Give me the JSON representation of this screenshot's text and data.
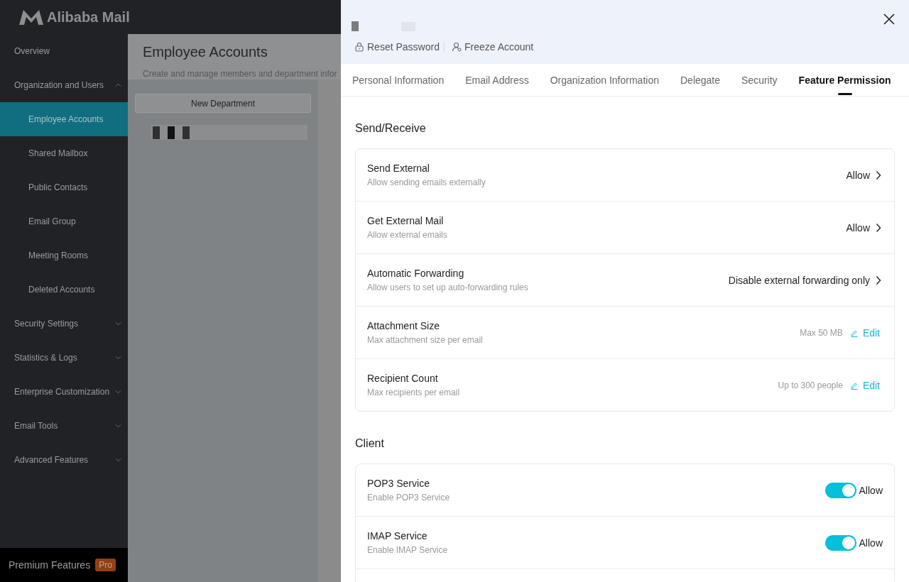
{
  "app": {
    "logo_text": "Alibaba Mail"
  },
  "sidebar": {
    "items": [
      {
        "label": "Overview",
        "kind": "link",
        "selected": false
      },
      {
        "label": "Organization and Users",
        "kind": "group",
        "expanded": true,
        "selected": false,
        "children": [
          {
            "label": "Employee Accounts",
            "selected": true
          },
          {
            "label": "Shared Mailbox",
            "selected": false
          },
          {
            "label": "Public Contacts",
            "selected": false
          },
          {
            "label": "Email Group",
            "selected": false
          },
          {
            "label": "Meeting Rooms",
            "selected": false
          },
          {
            "label": "Deleted Accounts",
            "selected": false
          }
        ]
      },
      {
        "label": "Security Settings",
        "kind": "group",
        "expanded": false,
        "selected": false
      },
      {
        "label": "Statistics & Logs",
        "kind": "group",
        "expanded": false,
        "selected": false
      },
      {
        "label": "Enterprise Customization",
        "kind": "group",
        "expanded": false,
        "selected": false
      },
      {
        "label": "Email Tools",
        "kind": "group",
        "expanded": false,
        "selected": false
      },
      {
        "label": "Advanced Features",
        "kind": "group",
        "expanded": false,
        "selected": false
      }
    ],
    "footer": {
      "label": "Premium Features",
      "badge": "Pro"
    }
  },
  "page": {
    "title": "Employee Accounts",
    "subtitle": "Create and manage members and department infor",
    "new_department_button": "New Department"
  },
  "drawer": {
    "actions": [
      "Reset Password",
      "Freeze Account"
    ],
    "tabs": [
      {
        "label": "Personal Information",
        "selected": false
      },
      {
        "label": "Email Address",
        "selected": false
      },
      {
        "label": "Organization Information",
        "selected": false
      },
      {
        "label": "Delegate",
        "selected": false
      },
      {
        "label": "Security",
        "selected": false
      },
      {
        "label": "Feature Permission",
        "selected": true
      }
    ],
    "sections": [
      {
        "title": "Send/Receive",
        "rows": [
          {
            "kind": "link",
            "title": "Send External",
            "description": "Allow sending emails externally",
            "value": "Allow"
          },
          {
            "kind": "link",
            "title": "Get External Mail",
            "description": "Allow external emails",
            "value": "Allow"
          },
          {
            "kind": "link",
            "title": "Automatic Forwarding",
            "description": "Allow users to set up auto-forwarding rules",
            "value": "Disable external forwarding only"
          },
          {
            "kind": "edit",
            "title": "Attachment Size",
            "description": "Max attachment size per email",
            "value": "Max 50 MB",
            "action": "Edit"
          },
          {
            "kind": "edit",
            "title": "Recipient Count",
            "description": "Max recipients per email",
            "value": "Up to 300 people",
            "action": "Edit"
          }
        ]
      },
      {
        "title": "Client",
        "rows": [
          {
            "kind": "toggle",
            "title": "POP3 Service",
            "description": "Enable POP3 Service",
            "on": true,
            "value": "Allow"
          },
          {
            "kind": "toggle",
            "title": "IMAP Service",
            "description": "Enable IMAP Service",
            "on": true,
            "value": "Allow"
          },
          {
            "kind": "blank"
          }
        ]
      }
    ]
  }
}
